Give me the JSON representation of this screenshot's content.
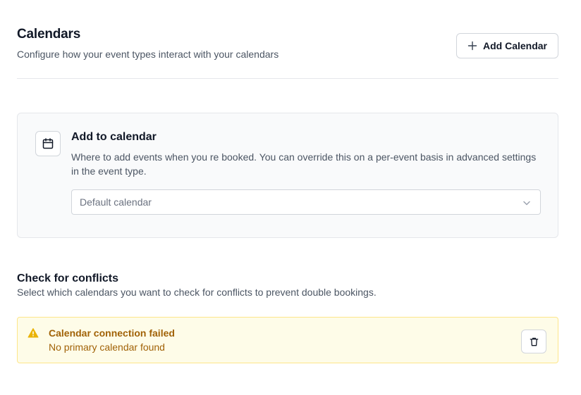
{
  "header": {
    "title": "Calendars",
    "subtitle": "Configure how your event types interact with your calendars",
    "add_button_label": "Add Calendar",
    "add_button_icon": "plus-icon"
  },
  "add_to_calendar": {
    "icon": "calendar-icon",
    "title": "Add to calendar",
    "description": "Where to add events when you re booked. You can override this on a per-event basis in advanced settings in the event type.",
    "select_value": "Default calendar",
    "select_icon": "chevron-down-icon"
  },
  "conflicts": {
    "title": "Check for conflicts",
    "description": "Select which calendars you want to check for conflicts to prevent double bookings."
  },
  "alert": {
    "icon": "warning-icon",
    "title": "Calendar connection failed",
    "message": "No primary calendar found",
    "action_icon": "trash-icon",
    "color": "#a16207",
    "background": "#fefce8"
  }
}
